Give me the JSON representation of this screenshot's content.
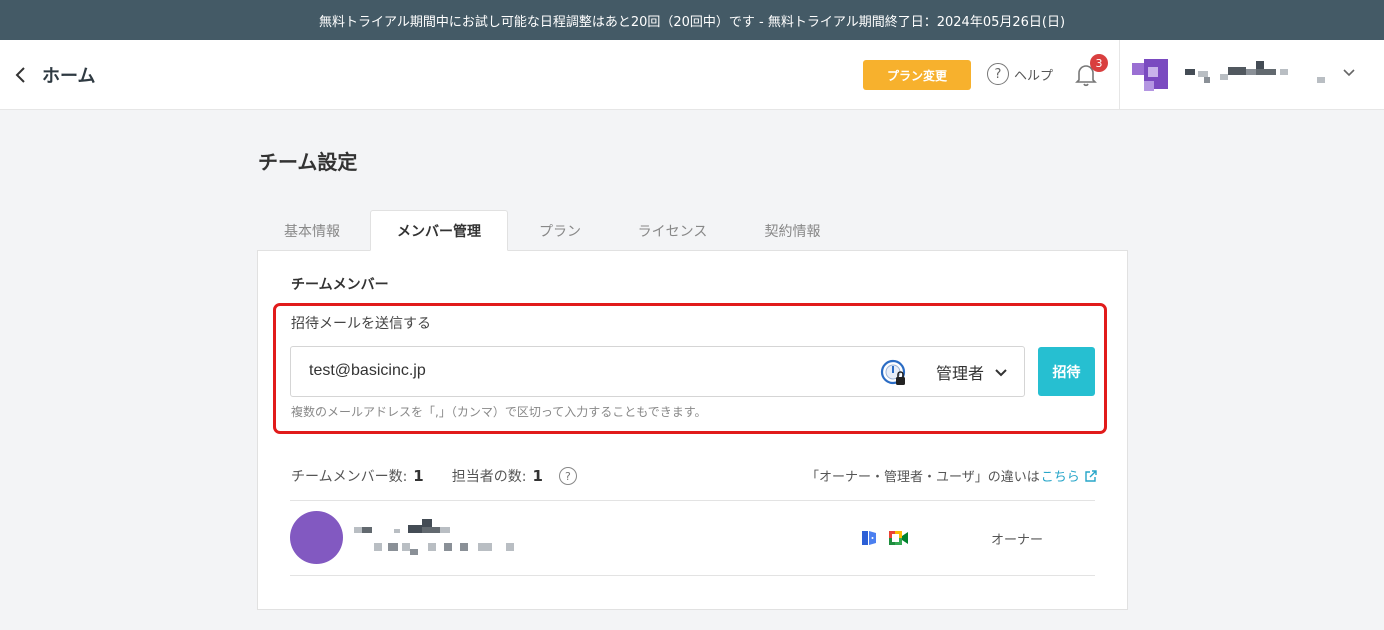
{
  "banner": {
    "text": "無料トライアル期間中にお試し可能な日程調整はあと20回（20回中）です - 無料トライアル期間終了日：2024年05月26日(日)"
  },
  "header": {
    "back_label": "ホーム",
    "plan_button": "プラン変更",
    "help_label": "ヘルプ",
    "notification_count": "3"
  },
  "page": {
    "title": "チーム設定",
    "tabs": [
      {
        "label": "基本情報",
        "active": false
      },
      {
        "label": "メンバー管理",
        "active": true
      },
      {
        "label": "プラン",
        "active": false
      },
      {
        "label": "ライセンス",
        "active": false
      },
      {
        "label": "契約情報",
        "active": false
      }
    ]
  },
  "members": {
    "section_title": "チームメンバー",
    "invite": {
      "label": "招待メールを送信する",
      "email_value": "test@basicinc.jp",
      "role_value": "管理者",
      "button": "招待",
      "hint": "複数のメールアドレスを「,」（カンマ）で区切って入力することもできます。"
    },
    "stats": {
      "member_count_label": "チームメンバー数:",
      "member_count": "1",
      "assignee_count_label": "担当者の数:",
      "assignee_count": "1"
    },
    "diff_note": {
      "text": "「オーナー・管理者・ユーザ」の違いは",
      "link": "こちら"
    },
    "rows": [
      {
        "role": "オーナー"
      }
    ]
  },
  "colors": {
    "banner_bg": "#445a66",
    "plan_button": "#f7b12d",
    "invite_button": "#26bfd1",
    "highlight": "#e11b1b",
    "avatar": "#8259c1",
    "link": "#26a5c8"
  }
}
